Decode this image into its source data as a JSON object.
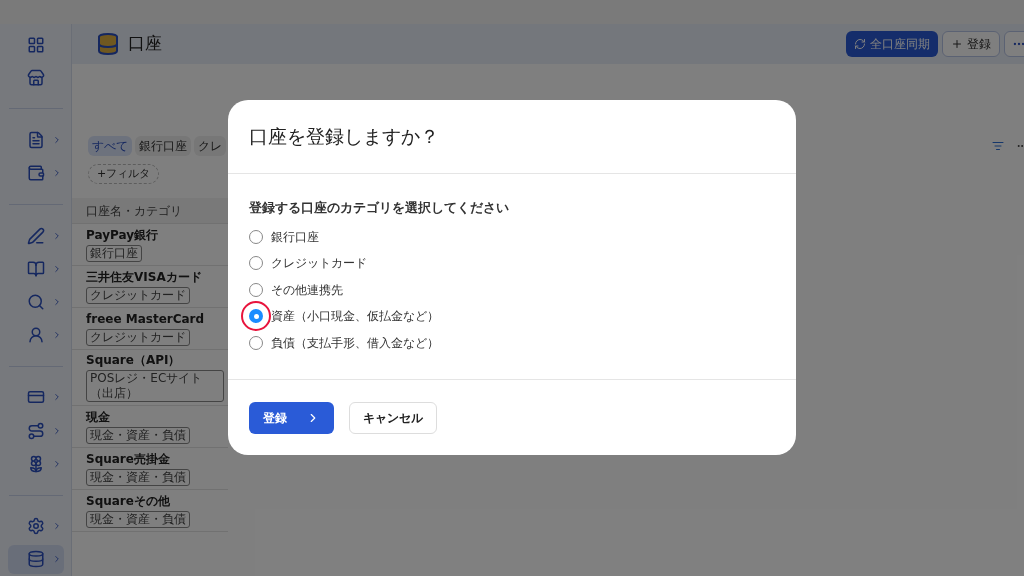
{
  "header": {
    "title": "口座",
    "buttons": [
      {
        "kind": "sync",
        "label": "全口座同期"
      },
      {
        "kind": "add",
        "label": "登録"
      },
      {
        "kind": "more"
      }
    ]
  },
  "sidebar": {
    "items": [
      {
        "expandable": false,
        "selected": false
      },
      {
        "expandable": false,
        "selected": false
      },
      {
        "expandable": true,
        "selected": false
      },
      {
        "expandable": true,
        "selected": false
      },
      {
        "expandable": true,
        "selected": false
      },
      {
        "expandable": true,
        "selected": false
      },
      {
        "expandable": true,
        "selected": false
      },
      {
        "expandable": true,
        "selected": false
      },
      {
        "expandable": true,
        "selected": false
      },
      {
        "expandable": true,
        "selected": false
      },
      {
        "expandable": true,
        "selected": false
      },
      {
        "expandable": true,
        "selected": false
      },
      {
        "expandable": true,
        "selected": true
      }
    ]
  },
  "filters": {
    "tabs": [
      {
        "label": "すべて",
        "selected": true
      },
      {
        "label": "銀行口座",
        "selected": false
      },
      {
        "label": "クレ",
        "selected": false
      }
    ],
    "add_filter": "+フィルタ"
  },
  "table": {
    "columns": [
      "口座名・カテゴリ"
    ],
    "rows": [
      {
        "name": "PayPay銀行",
        "category": "銀行口座"
      },
      {
        "name": "三井住友VISAカード",
        "category": "クレジットカード"
      },
      {
        "name": "freee MasterCard",
        "category": "クレジットカード"
      },
      {
        "name": "Square（API）",
        "category": "POSレジ・ECサイト（出店）"
      },
      {
        "name": "現金",
        "category": "現金・資産・負債"
      },
      {
        "name": "Square売掛金",
        "category": "現金・資産・負債"
      },
      {
        "name": "Squareその他",
        "category": "現金・資産・負債"
      }
    ]
  },
  "dialog": {
    "title": "口座を登録しますか？",
    "question": "登録する口座のカテゴリを選択してください",
    "options": [
      {
        "label": "銀行口座",
        "selected": false,
        "highlighted": false
      },
      {
        "label": "クレジットカード",
        "selected": false,
        "highlighted": false
      },
      {
        "label": "その他連携先",
        "selected": false,
        "highlighted": false
      },
      {
        "label": "資産（小口現金、仮払金など）",
        "selected": true,
        "highlighted": true
      },
      {
        "label": "負債（支払手形、借入金など）",
        "selected": false,
        "highlighted": false
      }
    ],
    "primary_button": "登録",
    "cancel_button": "キャンセル"
  }
}
